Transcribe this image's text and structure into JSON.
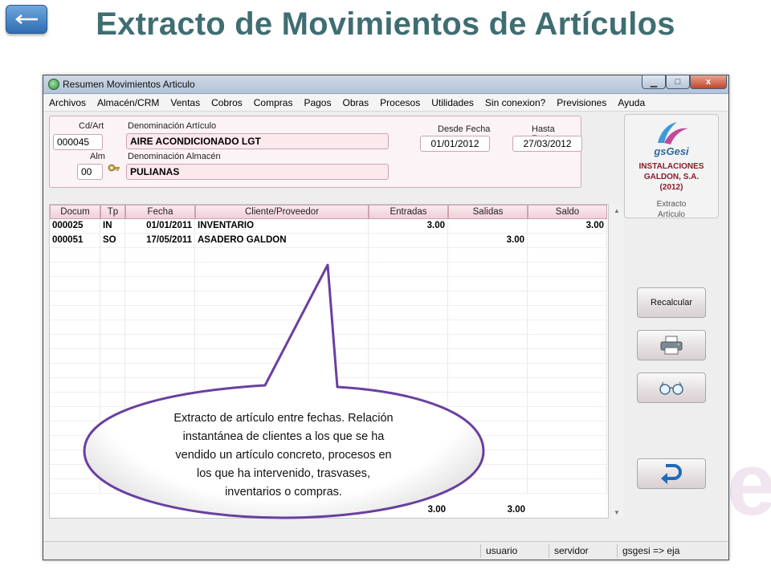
{
  "slide": {
    "title": "Extracto de Movimientos de Artículos",
    "back_icon": "back-arrow-icon"
  },
  "window": {
    "title": "Resumen Movimientos Articulo",
    "controls": {
      "minimize": "▁",
      "maximize": "□",
      "close": "x"
    }
  },
  "menu": [
    "Archivos",
    "Almacén/CRM",
    "Ventas",
    "Cobros",
    "Compras",
    "Pagos",
    "Obras",
    "Procesos",
    "Utilidades",
    "Sin conexion?",
    "Previsiones",
    "Ayuda"
  ],
  "form": {
    "cd_art_label": "Cd/Art",
    "cd_art_value": "000045",
    "denominacion_articulo_label": "Denominación Artículo",
    "denominacion_articulo_value": "AIRE ACONDICIONADO LGT",
    "desde_fecha_label": "Desde Fecha",
    "desde_fecha_value": "01/01/2012",
    "hasta_fecha_label": "Hasta Fecha",
    "hasta_fecha_value": "27/03/2012",
    "alm_label": "Alm",
    "alm_value": "00",
    "denominacion_almacen_label": "Denominación Almacén",
    "denominacion_almacen_value": "PULIANAS"
  },
  "logo": {
    "name": "gsGesi",
    "company_line1": "INSTALACIONES",
    "company_line2": "GALDON, S.A.",
    "company_line3": "(2012)",
    "caption_line1": "Extracto",
    "caption_line2": "Artículo"
  },
  "table": {
    "columns": [
      "Docum",
      "Tp",
      "Fecha",
      "Cliente/Proveedor",
      "Entradas",
      "Salidas",
      "Saldo"
    ],
    "rows": [
      [
        "000025",
        "IN",
        "01/01/2011",
        "INVENTARIO",
        "3.00",
        "",
        "3.00"
      ],
      [
        "000051",
        "SO",
        "17/05/2011",
        "ASADERO GALDON",
        "",
        "3.00",
        ""
      ]
    ],
    "totals": {
      "entradas": "3.00",
      "salidas": "3.00"
    }
  },
  "side_buttons": {
    "recalcular_label": "Recalcular",
    "print_icon": "printer-icon",
    "view_icon": "glasses-icon",
    "return_icon": "return-arrow-icon"
  },
  "status": {
    "user": "usuario",
    "server": "servidor",
    "db": "gsgesi => eja"
  },
  "callout": {
    "line1": "Extracto de artículo entre fechas. Relación",
    "line2": "instantánea de clientes  a los que se ha",
    "line3": "vendido un artículo concreto, procesos en",
    "line4": "los que ha intervenido, trasvases,",
    "line5": "inventarios o compras."
  },
  "colors": {
    "title": "#3f6e72",
    "accent_pink": "#f0cfd8",
    "callout_border": "#6a3fa0",
    "brand_blue": "#2f6aa3",
    "brand_red": "#8b1a2b"
  }
}
